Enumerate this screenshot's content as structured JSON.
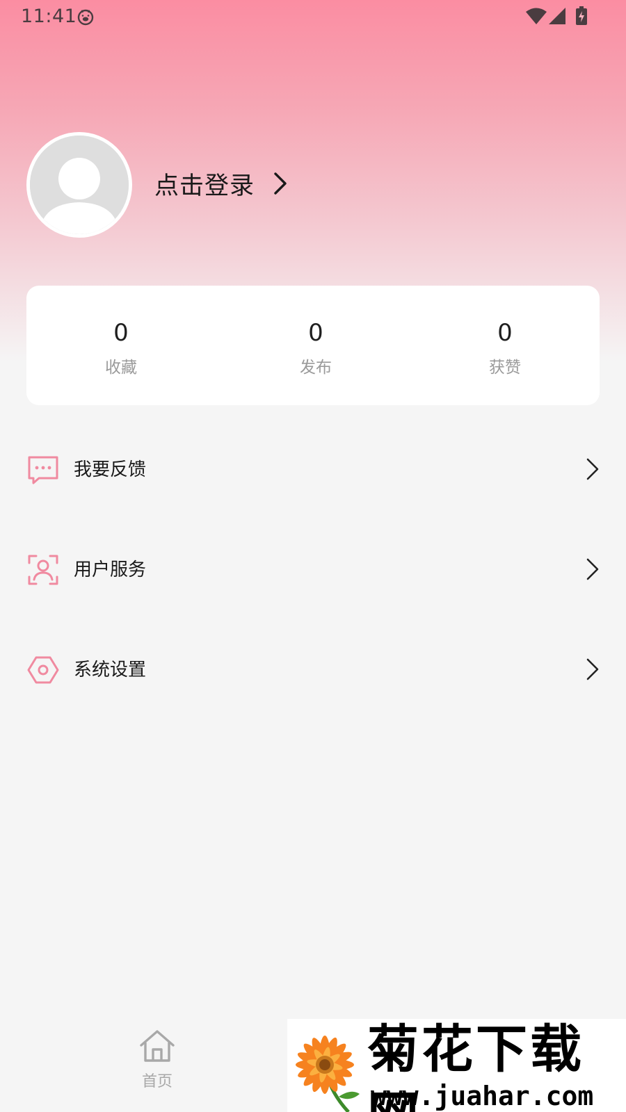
{
  "status_bar": {
    "time": "11:41"
  },
  "profile": {
    "login_label": "点击登录"
  },
  "stats": [
    {
      "value": "0",
      "label": "收藏"
    },
    {
      "value": "0",
      "label": "发布"
    },
    {
      "value": "0",
      "label": "获赞"
    }
  ],
  "menu": [
    {
      "label": "我要反馈",
      "icon": "feedback-icon"
    },
    {
      "label": "用户服务",
      "icon": "user-service-icon"
    },
    {
      "label": "系统设置",
      "icon": "settings-icon"
    }
  ],
  "bottom_nav": {
    "home_label": "首页"
  },
  "watermark": {
    "title": "菊花下载网",
    "url": "www.juahar.com"
  },
  "colors": {
    "accent_pink": "#f08aa0",
    "header_top": "#fb8da2",
    "background": "#f5f5f5"
  }
}
